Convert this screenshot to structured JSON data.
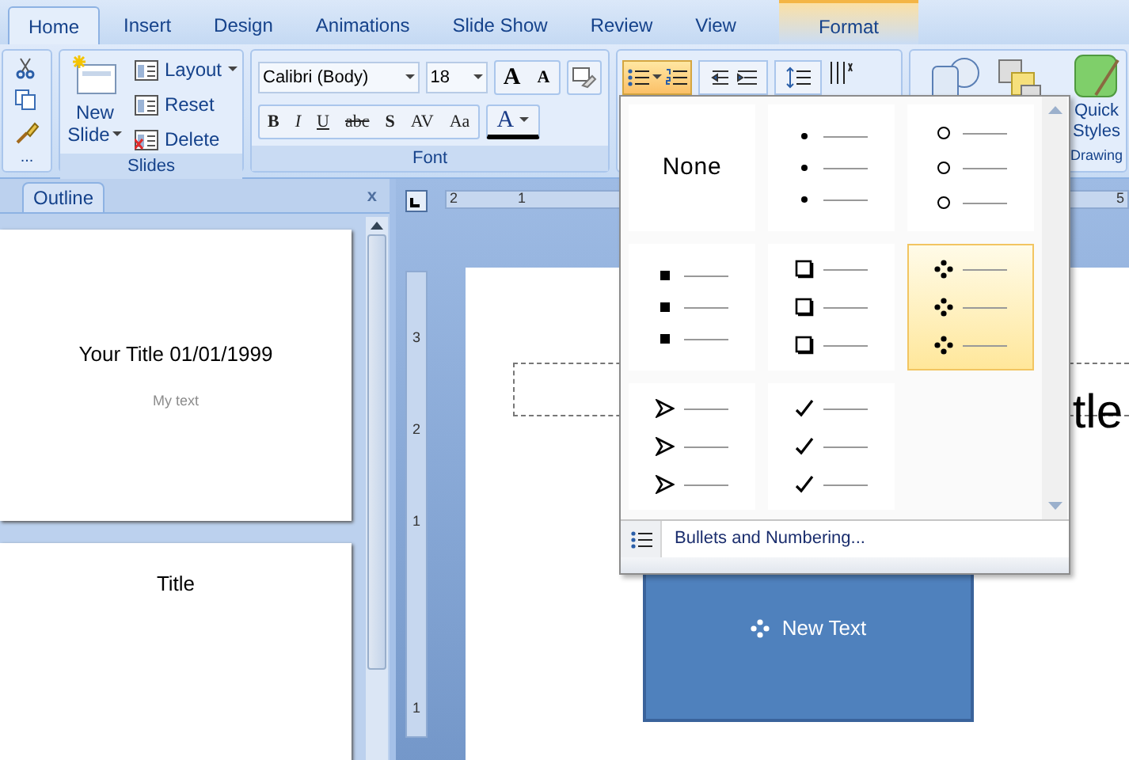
{
  "tabs": [
    {
      "label": "Home",
      "selected": true
    },
    {
      "label": "Insert",
      "selected": false
    },
    {
      "label": "Design",
      "selected": false
    },
    {
      "label": "Animations",
      "selected": false
    },
    {
      "label": "Slide Show",
      "selected": false
    },
    {
      "label": "Review",
      "selected": false
    },
    {
      "label": "View",
      "selected": false
    }
  ],
  "contextual_tab": {
    "label": "Format"
  },
  "clipboard_group": {
    "label": "..."
  },
  "slides_group": {
    "label": "Slides",
    "new_slide": [
      "New",
      "Slide"
    ],
    "commands": [
      "Layout",
      "Reset",
      "Delete"
    ]
  },
  "font_group": {
    "label": "Font",
    "font_name": "Calibri (Body)",
    "font_size": "18",
    "grow": "A",
    "shrink": "A",
    "format_buttons": [
      "B",
      "I",
      "U",
      "abc",
      "S",
      "AV",
      "Aa"
    ],
    "font_color": "A"
  },
  "drawing_group": {
    "label": "Drawing",
    "quick_styles": [
      "Quick",
      "Styles"
    ]
  },
  "outline_pane": {
    "tab": "Outline",
    "close": "x"
  },
  "thumbnails": [
    {
      "title": "Your Title 01/01/1999",
      "subtitle": "My text"
    },
    {
      "title": "Title"
    }
  ],
  "horizontal_ruler": [
    "2",
    "1",
    "5"
  ],
  "vertical_ruler": [
    "3",
    "2",
    "1",
    "1"
  ],
  "slide": {
    "title": "tle",
    "box_text": "New Text"
  },
  "bullet_gallery": {
    "items": [
      {
        "kind": "none",
        "label": "None",
        "selected": false
      },
      {
        "kind": "dot",
        "selected": false
      },
      {
        "kind": "circle",
        "selected": false
      },
      {
        "kind": "square",
        "selected": false
      },
      {
        "kind": "box",
        "selected": false
      },
      {
        "kind": "diamond",
        "selected": true
      },
      {
        "kind": "arrow",
        "selected": false
      },
      {
        "kind": "check",
        "selected": false
      }
    ],
    "footer": "Bullets and Numbering..."
  }
}
